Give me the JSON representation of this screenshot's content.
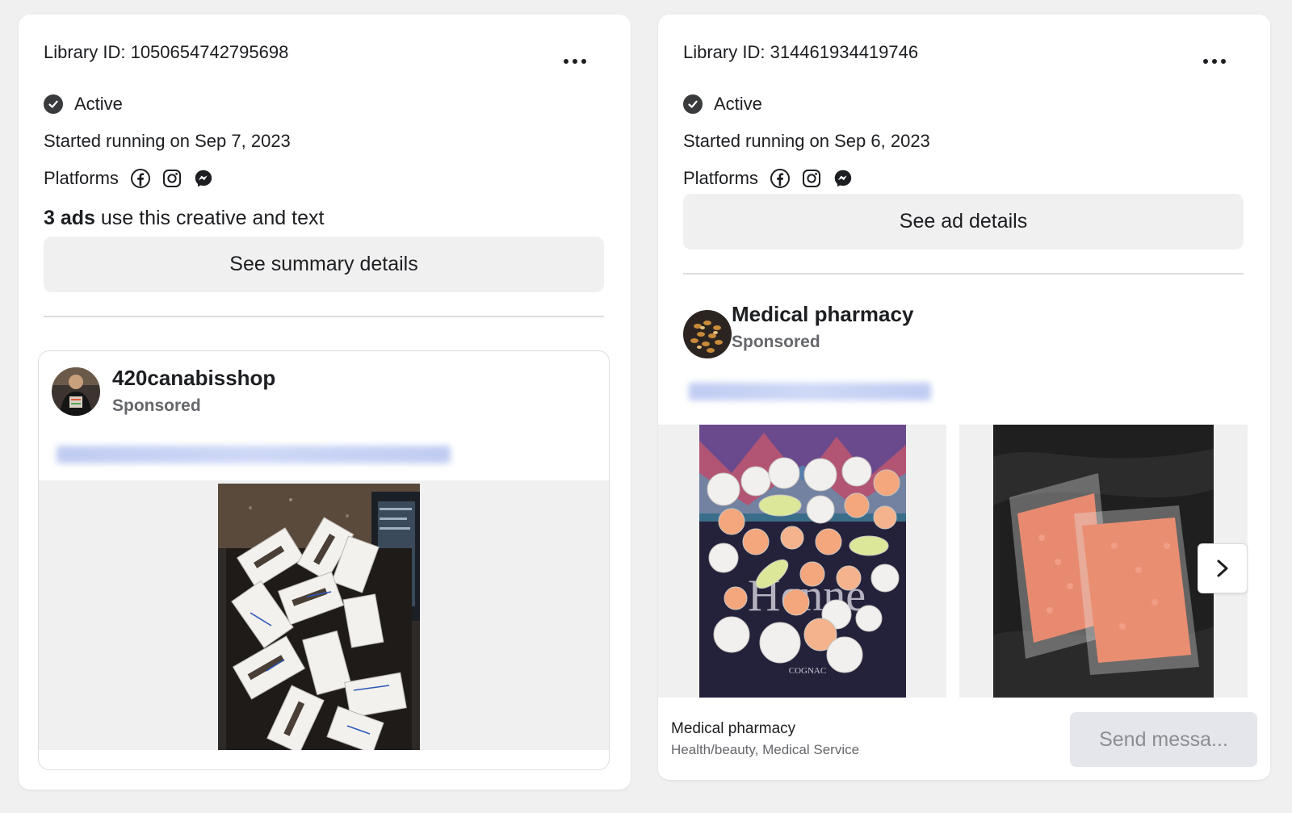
{
  "left_card": {
    "library_id": "Library ID: 1050654742795698",
    "status": "Active",
    "started": "Started running on Sep 7, 2023",
    "platforms_label": "Platforms",
    "platform_icons": [
      "facebook-icon",
      "instagram-icon",
      "messenger-icon"
    ],
    "ads_count_bold": "3 ads",
    "ads_count_rest": " use this creative and text",
    "summary_button": "See summary details",
    "ad": {
      "page_name": "420canabisshop",
      "sponsored": "Sponsored"
    }
  },
  "right_card": {
    "library_id": "Library ID: 314461934419746",
    "status": "Active",
    "started": "Started running on Sep 6, 2023",
    "platforms_label": "Platforms",
    "platform_icons": [
      "facebook-icon",
      "instagram-icon",
      "messenger-icon"
    ],
    "details_button": "See ad details",
    "ad": {
      "page_name": "Medical pharmacy",
      "sponsored": "Sponsored",
      "footer_name": "Medical pharmacy",
      "footer_category": "Health/beauty, Medical Service",
      "cta_button": "Send messa...",
      "image_caption": "COGNAC"
    }
  },
  "colors": {
    "background": "#f0f0f0",
    "card": "#ffffff",
    "text_primary": "#1c1e21",
    "text_secondary": "#65676b",
    "button_bg": "#f0f0f0",
    "cta_disabled_bg": "#e4e6eb",
    "cta_disabled_text": "#8a8d91"
  }
}
